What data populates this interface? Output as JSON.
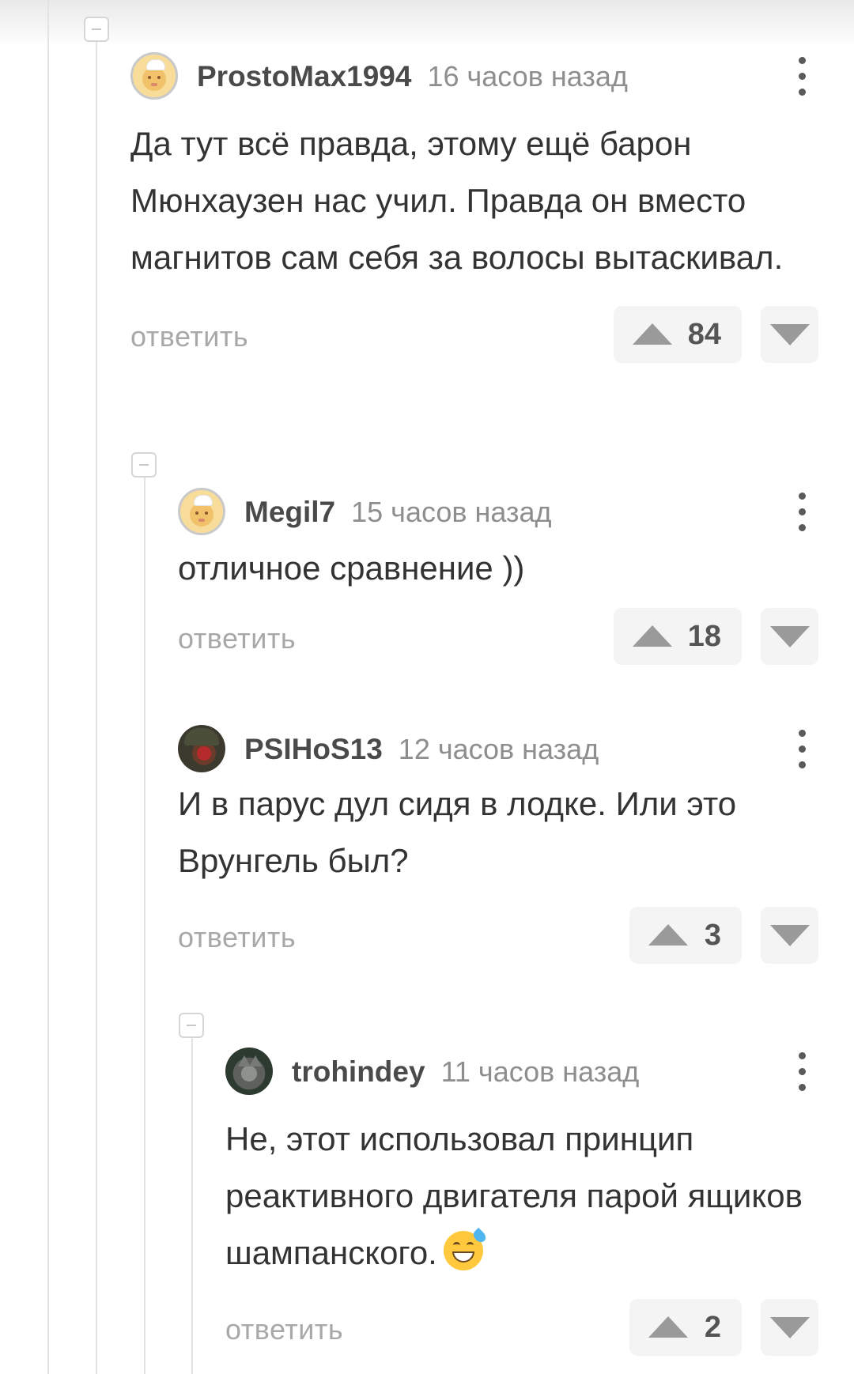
{
  "comments": [
    {
      "username": "ProstoMax1994",
      "time": "16 часов назад",
      "text": "Да тут всё правда, этому ещё барон Мюнхаузен нас учил. Правда он вместо магнитов сам себя за волосы вытаскивал.",
      "reply": "ответить",
      "votes": "84",
      "avatar": "default-avatar"
    },
    {
      "username": "Megil7",
      "time": "15 часов назад",
      "text": "отличное сравнение ))",
      "reply": "ответить",
      "votes": "18",
      "avatar": "default-avatar"
    },
    {
      "username": "PSIHoS13",
      "time": "12 часов назад",
      "text": "И в парус дул сидя в лодке. Или это Врунгель был?",
      "reply": "ответить",
      "votes": "3",
      "avatar": "photo-avatar"
    },
    {
      "username": "trohindey",
      "time": "11 часов назад",
      "text": "Не, этот использовал принцип реактивного двигателя парой ящиков шампанского.",
      "emoji": "grinning-face-with-sweat",
      "reply": "ответить",
      "votes": "2",
      "avatar": "photo-avatar"
    }
  ],
  "icons": {
    "collapse": "collapse-thread-icon",
    "more": "more-vertical-icon",
    "upvote": "upvote-arrow-icon",
    "downvote": "downvote-arrow-icon"
  },
  "colors": {
    "text": "#333333",
    "meta": "#8e8e8e",
    "vote_bg": "#f4f4f4",
    "thread_line": "#e3e3e3"
  }
}
